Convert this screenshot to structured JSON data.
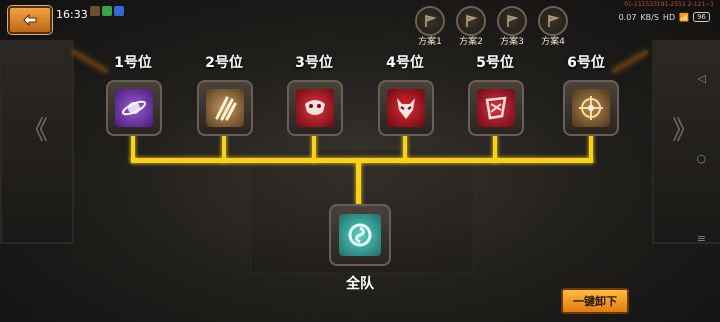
{
  "status": {
    "time": "16:33",
    "network_speed": "0.07",
    "network_unit": "KB/S",
    "hd_label": "HD",
    "battery": "96",
    "debug_text": "01-111533191-2551 2-121~1"
  },
  "toolbar": {
    "back_icon": "back-arrow-icon"
  },
  "plans": [
    {
      "label": "方案1"
    },
    {
      "label": "方案2"
    },
    {
      "label": "方案3"
    },
    {
      "label": "方案4"
    }
  ],
  "slots": [
    {
      "label": "1号位",
      "icon": "planet-ring-icon",
      "color": "#6b2ea6"
    },
    {
      "label": "2号位",
      "icon": "claw-slash-icon",
      "color": "#8a6a44"
    },
    {
      "label": "3号位",
      "icon": "beast-skull-icon",
      "color": "#a11d24"
    },
    {
      "label": "4号位",
      "icon": "demon-mask-icon",
      "color": "#b11a26"
    },
    {
      "label": "5号位",
      "icon": "armor-chest-icon",
      "color": "#a3182a"
    },
    {
      "label": "6号位",
      "icon": "crosshair-target-icon",
      "color": "#7a5a36"
    }
  ],
  "team": {
    "label": "全队",
    "icon": "team-swirl-icon",
    "color": "#2ea79a"
  },
  "actions": {
    "unload_label": "一键卸下"
  }
}
